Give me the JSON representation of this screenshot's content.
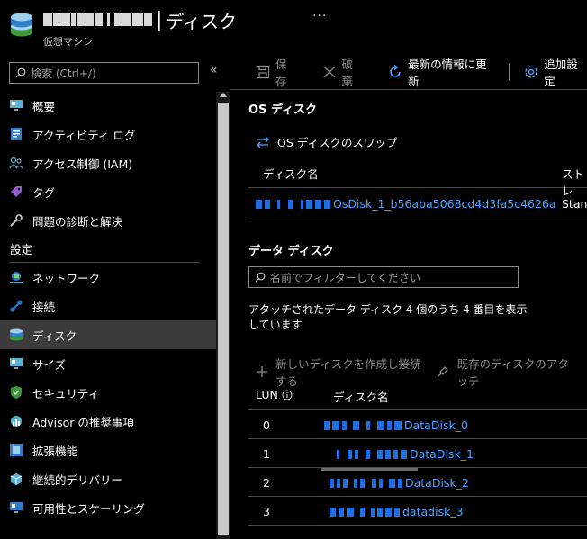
{
  "header": {
    "title": "ディスク",
    "separator": "|",
    "subtitle": "仮想マシン",
    "more": "···"
  },
  "sidebar": {
    "search_placeholder": "検索 (Ctrl+/)",
    "collapse": "«",
    "items_top": [
      {
        "label": "概要",
        "icon": "monitor-icon"
      },
      {
        "label": "アクティビティ ログ",
        "icon": "log-icon"
      },
      {
        "label": "アクセス制御 (IAM)",
        "icon": "people-icon"
      },
      {
        "label": "タグ",
        "icon": "tag-icon"
      },
      {
        "label": "問題の診断と解決",
        "icon": "wrench-icon"
      }
    ],
    "section_label": "設定",
    "items_settings": [
      {
        "label": "ネットワーク",
        "icon": "network-icon"
      },
      {
        "label": "接続",
        "icon": "connect-icon"
      },
      {
        "label": "ディスク",
        "icon": "disk-icon",
        "active": true
      },
      {
        "label": "サイズ",
        "icon": "size-icon"
      },
      {
        "label": "セキュリティ",
        "icon": "shield-icon"
      },
      {
        "label": "Advisor の推奨事項",
        "icon": "advisor-icon"
      },
      {
        "label": "拡張機能",
        "icon": "extensions-icon"
      },
      {
        "label": "継続的デリバリー",
        "icon": "delivery-icon"
      },
      {
        "label": "可用性とスケーリング",
        "icon": "scaling-icon"
      }
    ]
  },
  "toolbar": {
    "save": "保存",
    "discard": "破棄",
    "refresh": "最新の情報に更新",
    "additional": "追加設定"
  },
  "os_disk": {
    "heading": "OS ディスク",
    "swap": "OS ディスクのスワップ",
    "col_name": "ディスク名",
    "col_storage": "ストレ",
    "row_name": "OsDisk_1_b56aba5068cd4d3fa5c4626a",
    "row_storage": "Stanc"
  },
  "data_disk": {
    "heading": "データ ディスク",
    "filter_placeholder": "名前でフィルターしてください",
    "info": "アタッチされたデータ ディスク 4 個のうち 4 番目を表示しています",
    "create_attach": "新しいディスクを作成し接続する",
    "attach_existing": "既存のディスクのアタッチ",
    "col_lun": "LUN",
    "col_name": "ディスク名",
    "rows": [
      {
        "lun": "0",
        "name": "DataDisk_0"
      },
      {
        "lun": "1",
        "name": "DataDisk_1"
      },
      {
        "lun": "2",
        "name": "DataDisk_2"
      },
      {
        "lun": "3",
        "name": "datadisk_3"
      }
    ]
  },
  "colors": {
    "link": "#4fa3ff",
    "background": "#000000",
    "active_nav": "#3b3b3b"
  }
}
